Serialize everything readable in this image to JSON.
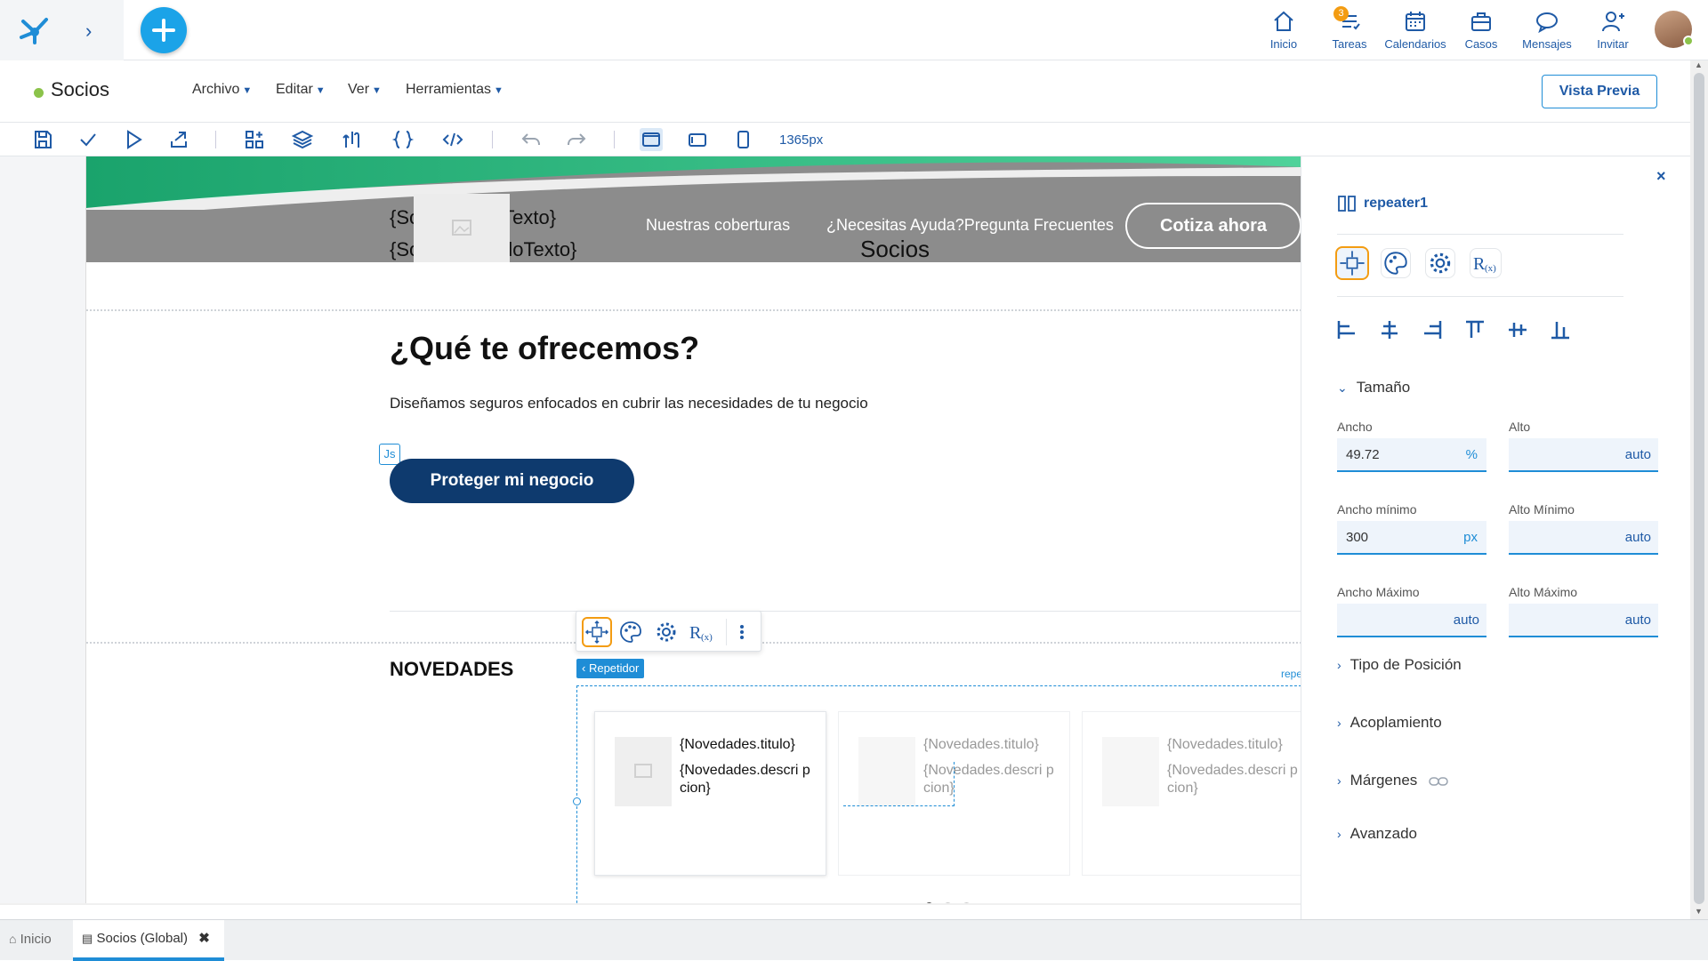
{
  "topbar": {
    "nav": [
      {
        "label": "Inicio",
        "icon": "home-icon"
      },
      {
        "label": "Tareas",
        "icon": "tasks-icon",
        "badge": "3"
      },
      {
        "label": "Calendarios",
        "icon": "calendar-icon"
      },
      {
        "label": "Casos",
        "icon": "briefcase-icon"
      },
      {
        "label": "Mensajes",
        "icon": "message-icon"
      },
      {
        "label": "Invitar",
        "icon": "add-user-icon"
      }
    ]
  },
  "titlebar": {
    "title": "Socios",
    "menus": [
      "Archivo",
      "Editar",
      "Ver",
      "Herramientas"
    ],
    "preview_button": "Vista Previa"
  },
  "toolbar": {
    "width_readout": "1365px"
  },
  "canvas": {
    "header_text1": "{SocioPrimerTexto}",
    "header_text2": "{SocioSegundoTexto}",
    "header_link1": "Nuestras coberturas",
    "header_link2": "¿Necesitas Ayuda?Pregunta Frecuentes",
    "header_cta": "Cotiza ahora",
    "header_overlay": "Socios",
    "heading": "¿Qué te ofrecemos?",
    "paragraph": "Diseñamos seguros enfocados en cubrir las necesidades de tu negocio",
    "js_badge": "Js",
    "protect_button": "Proteger mi negocio",
    "news_title": "NOVEDADES",
    "repeater_tag": "Repetidor",
    "repeater_edge_label": "repe",
    "cards": [
      {
        "title": "{Novedades.titulo}",
        "desc": "{Novedades.descri pcion}",
        "active": true
      },
      {
        "title": "{Novedades.titulo}",
        "desc": "{Novedades.descri pcion}",
        "active": false
      },
      {
        "title": "{Novedades.titulo}",
        "desc": "{Novedades.descri pcion}",
        "active": false
      }
    ]
  },
  "panel": {
    "component_name": "repeater1",
    "size_section": "Tamaño",
    "fields": {
      "ancho_label": "Ancho",
      "ancho_value": "49.72",
      "ancho_unit": "%",
      "alto_label": "Alto",
      "alto_value": "auto",
      "ancho_min_label": "Ancho mínimo",
      "ancho_min_value": "300",
      "ancho_min_unit": "px",
      "alto_min_label": "Alto Mínimo",
      "alto_min_value": "auto",
      "ancho_max_label": "Ancho Máximo",
      "ancho_max_value": "auto",
      "alto_max_label": "Alto Máximo",
      "alto_max_value": "auto"
    },
    "sections": [
      "Tipo de Posición",
      "Acoplamiento",
      "Márgenes",
      "Avanzado"
    ]
  },
  "bottombar": {
    "tabs": [
      "Inicio",
      "Socios (Global)"
    ]
  },
  "colors": {
    "accent": "#1f8dd6",
    "brand_blue": "#1f5aa6",
    "primary_button": "#0e3a6e",
    "selection_orange": "#f39c12",
    "green_status": "#8bc34a"
  }
}
